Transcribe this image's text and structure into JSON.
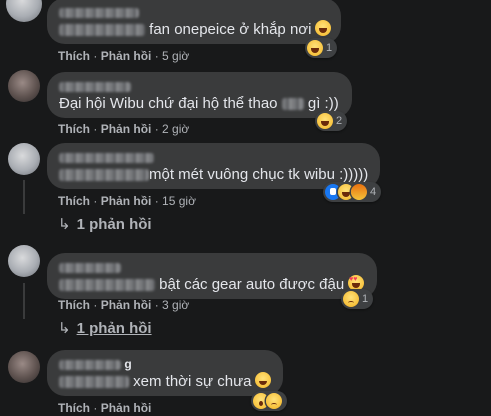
{
  "labels": {
    "like": "Thích",
    "reply": "Phản hồi",
    "separator": "·"
  },
  "comments": [
    {
      "text": "fan onepeice ở khắp nơi",
      "time": "5 giờ",
      "reaction_count": "1",
      "reactions": [
        "haha"
      ]
    },
    {
      "text": "Đại hội Wibu chứ đại hộ thể thao",
      "text_after": "gì :))",
      "time": "2 giờ",
      "reaction_count": "2",
      "reactions": [
        "haha"
      ]
    },
    {
      "text": "một mét vuông chục tk wibu :)))))",
      "time": "15 giờ",
      "reaction_count": "4",
      "reactions": [
        "like",
        "haha",
        "angry"
      ],
      "replies": "1 phản hồi"
    },
    {
      "text": "bật các gear auto được đậu",
      "time": "3 giờ",
      "reaction_count": "1",
      "reactions": [
        "sad"
      ],
      "replies": "1 phản hồi"
    },
    {
      "text": "xem thời sự chưa",
      "author_suffix": "g",
      "reaction_count": "",
      "reactions": [
        "wow",
        "sad"
      ]
    }
  ],
  "colors": {
    "background": "#18191a",
    "bubble": "#3a3b3c",
    "text": "#e4e6eb",
    "secondary": "#b0b3b8",
    "like_blue": "#1877f2"
  }
}
